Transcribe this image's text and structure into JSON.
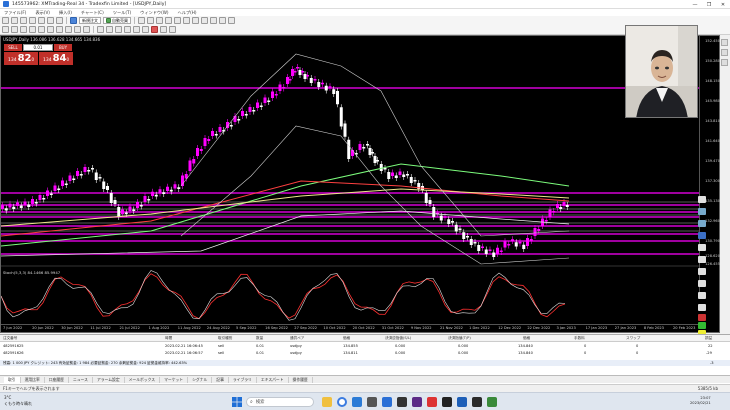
{
  "window": {
    "title": "145573962: XMTrading-Real 34 - Tradexfin Limited - [USDJPY,Daily]",
    "controls": [
      "—",
      "❐",
      "✕"
    ]
  },
  "menu": [
    "ファイル(F)",
    "表示(V)",
    "挿入(I)",
    "チャート(C)",
    "ツール(T)",
    "ウィンドウ(W)",
    "ヘルプ(H)"
  ],
  "toolbar": {
    "new_order_label": "新規注文",
    "autotrade_label": "自動売買"
  },
  "chart": {
    "header": "USDJPY,Daily 136.086 136.628 134.665 134.836",
    "symbol": "USDJPY",
    "oscillator_label": "Stoch(5,3,3) 84.1466 85.9947",
    "trade_panel": {
      "sell_label": "SELL",
      "buy_label": "BUY",
      "lot": "0.01",
      "sell_prefix": "134",
      "sell_big": "82",
      "sell_sup": "0",
      "buy_prefix": "134",
      "buy_big": "84",
      "buy_sup": "0"
    },
    "price_labels": [
      "152.450",
      "150.280",
      "148.150",
      "145.980",
      "143.810",
      "141.640",
      "139.470",
      "137.300",
      "135.130",
      "132.960",
      "130.790",
      "128.620",
      "126.455"
    ],
    "time_labels": [
      "7 Jun 2022",
      "20 Jun 2022",
      "30 Jun 2022",
      "11 Jul 2022",
      "21 Jul 2022",
      "1 Aug 2022",
      "11 Aug 2022",
      "24 Aug 2022",
      "5 Sep 2022",
      "16 Sep 2022",
      "27 Sep 2022",
      "10 Oct 2022",
      "20 Oct 2022",
      "31 Oct 2022",
      "9 Nov 2022",
      "21 Nov 2022",
      "1 Dec 2022",
      "12 Dec 2022",
      "22 Dec 2022",
      "3 Jan 2023",
      "17 Jan 2023",
      "27 Jan 2023",
      "8 Feb 2023",
      "20 Feb 2023"
    ],
    "colors": {
      "background": "#000000",
      "bull": "#ff00ff",
      "bear": "#ffffff",
      "hline": "#d400d4",
      "ma_green": "#7cfc7c",
      "ma_red": "#ff4040",
      "ma_yellow": "#f0e68c"
    }
  },
  "terminal": {
    "columns": [
      "注文番号",
      "時間",
      "取引種別",
      "数量",
      "通貨ペア",
      "価格",
      "決済逆指値(S/L)",
      "決済指値(T/P)",
      "価格",
      "手数料",
      "スワップ",
      "損益"
    ],
    "rows": [
      [
        "482591625",
        "2023.02.21 16:06:45",
        "sell",
        "0.01",
        "usdjpy",
        "134.855",
        "0.000",
        "0.000",
        "134.840",
        "0",
        "0",
        "22"
      ],
      [
        "482591626",
        "2023.02.21 16:06:57",
        "sell",
        "0.01",
        "usdjpy",
        "134.811",
        "0.000",
        "0.000",
        "134.840",
        "0",
        "0",
        "-29"
      ]
    ],
    "balance": "残高: 1 000 JPY  クレジット: 243  有効証拠金: 1 984  必要証拠金: 270  余剰証拠金: 924  証拠金維持率: 442.63%",
    "balance_total": "-3",
    "tabs": [
      "取引",
      "運用比率",
      "口座履歴",
      "ニュース",
      "アラーム設定",
      "メールボックス",
      "マーケット",
      "シグナル",
      "記事",
      "ライブラリ",
      "エキスパート",
      "操作履歴"
    ]
  },
  "status": {
    "help_text": "F1キーでヘルプを表示されます",
    "right_text": "5385/5 kb"
  },
  "taskbar": {
    "weather_temp": "3°C",
    "weather_desc": "くもり時々晴れ",
    "search_placeholder": "検索",
    "time": "23:07",
    "date": "2023/02/21"
  }
}
